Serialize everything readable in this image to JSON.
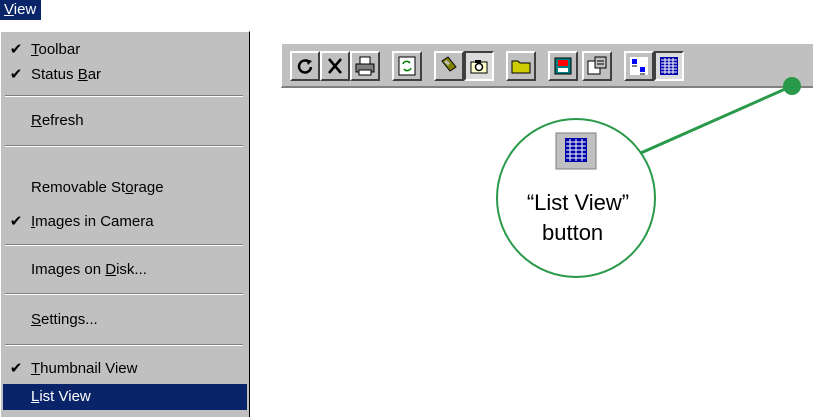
{
  "menu_bar": {
    "title_mnemonic": "V",
    "title_rest": "iew"
  },
  "menu": {
    "items": [
      {
        "mnemonic": "T",
        "rest": "oolbar",
        "pre": "",
        "checked": true
      },
      {
        "pre": "Status ",
        "mnemonic": "B",
        "rest": "ar",
        "checked": true
      },
      {
        "mnemonic": "R",
        "rest": "efresh",
        "pre": "",
        "checked": false
      },
      {
        "pre": "Removable St",
        "mnemonic": "o",
        "rest": "rage",
        "checked": false
      },
      {
        "mnemonic": "I",
        "rest": "mages in Camera",
        "pre": "",
        "checked": true
      },
      {
        "pre": "Images on ",
        "mnemonic": "D",
        "rest": "isk...",
        "checked": false
      },
      {
        "mnemonic": "S",
        "rest": "ettings...",
        "pre": "",
        "checked": false
      },
      {
        "mnemonic": "T",
        "rest": "humbnail View",
        "pre": "",
        "checked": true
      },
      {
        "mnemonic": "L",
        "rest": "ist View",
        "pre": "",
        "checked": false,
        "highlighted": true
      }
    ],
    "check_glyph": "✔"
  },
  "toolbar": {
    "buttons": [
      {
        "icon": "rotate-icon"
      },
      {
        "icon": "delete-icon"
      },
      {
        "icon": "print-icon"
      },
      {
        "icon": "refresh-icon"
      },
      {
        "icon": "removable-storage-icon"
      },
      {
        "icon": "camera-icon",
        "pressed": true
      },
      {
        "icon": "folder-icon"
      },
      {
        "icon": "images-on-disk-icon"
      },
      {
        "icon": "settings-icon"
      },
      {
        "icon": "thumbnail-view-icon"
      },
      {
        "icon": "list-view-icon",
        "pressed": true
      }
    ]
  },
  "callout": {
    "line1": "“List View”",
    "line2": "button",
    "color": "#2a9a4a"
  },
  "colors": {
    "menu_bg": "#c0c0c0",
    "highlight": "#0a246a",
    "callout": "#2a9a4a"
  }
}
